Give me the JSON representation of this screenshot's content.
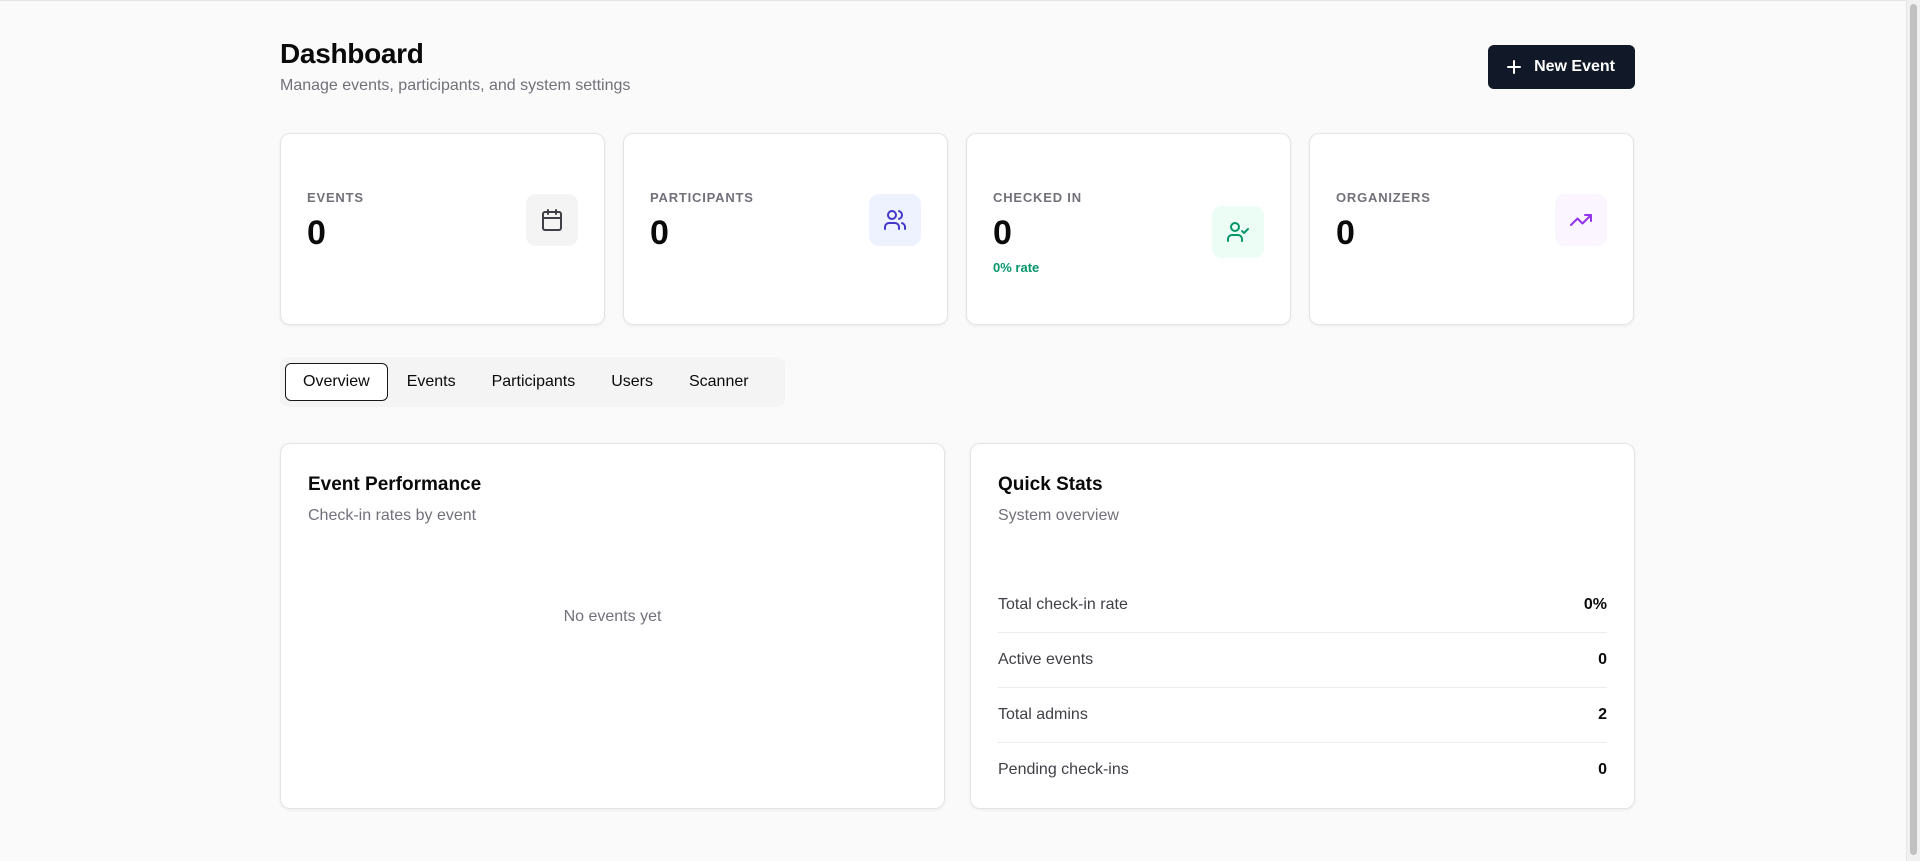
{
  "header": {
    "title": "Dashboard",
    "subtitle": "Manage events, participants, and system settings",
    "new_event_label": "New Event"
  },
  "stats": [
    {
      "label": "EVENTS",
      "value": "0",
      "icon": "calendar-icon",
      "icon_bg": "#f4f4f5",
      "icon_color": "#3f3f46"
    },
    {
      "label": "PARTICIPANTS",
      "value": "0",
      "icon": "users-icon",
      "icon_bg": "#eef2ff",
      "icon_color": "#4338ca"
    },
    {
      "label": "CHECKED IN",
      "value": "0",
      "note": "0% rate",
      "icon": "user-check-icon",
      "icon_bg": "#ecfdf5",
      "icon_color": "#059669"
    },
    {
      "label": "ORGANIZERS",
      "value": "0",
      "icon": "trending-up-icon",
      "icon_bg": "#faf5ff",
      "icon_color": "#9333ea"
    }
  ],
  "tabs": [
    {
      "label": "Overview",
      "active": true
    },
    {
      "label": "Events"
    },
    {
      "label": "Participants"
    },
    {
      "label": "Users"
    },
    {
      "label": "Scanner"
    }
  ],
  "event_performance": {
    "title": "Event Performance",
    "subtitle": "Check-in rates by event",
    "empty_text": "No events yet"
  },
  "quick_stats": {
    "title": "Quick Stats",
    "subtitle": "System overview",
    "rows": [
      {
        "label": "Total check-in rate",
        "value": "0%"
      },
      {
        "label": "Active events",
        "value": "0"
      },
      {
        "label": "Total admins",
        "value": "2"
      },
      {
        "label": "Pending check-ins",
        "value": "0"
      }
    ]
  }
}
